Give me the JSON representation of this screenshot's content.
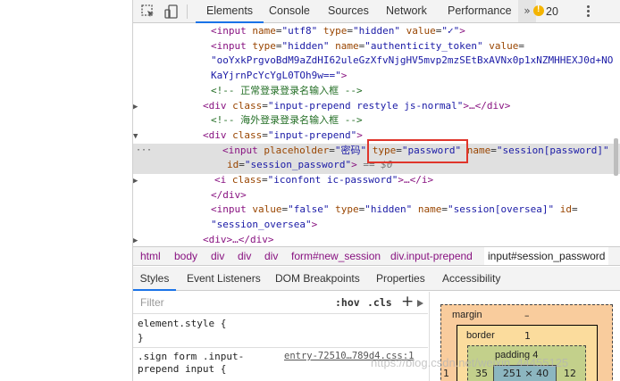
{
  "toolbar": {
    "tabs": [
      "Elements",
      "Console",
      "Sources",
      "Network",
      "Performance"
    ],
    "more": "»",
    "warnings_count": "20"
  },
  "dom": {
    "line1": {
      "tag_open": "<input ",
      "a1": "name",
      "v1": "\"utf8\"",
      "a2": "type",
      "v2": "\"hidden\"",
      "a3": "value",
      "v3": "\"✓\"",
      "close": ">"
    },
    "line2": {
      "tag_open": "<input ",
      "a1": "type",
      "v1": "\"hidden\"",
      "a2": "name",
      "v2": "\"authenticity_token\"",
      "a3": "value",
      "eq": "="
    },
    "line3": "\"ooYxkPrgvoBdM9aZdHI62uleGzXfvNjgHV5mvp2mzSEtBxAVNx0p1xNZMHHEXJ0d+NO",
    "line4": "KaYjrnPcYcYgL0TOh9w==\"",
    "line4_close": ">",
    "comment1": "<!-- 正常登录登录名输入框 -->",
    "line6": {
      "tag_open": "<div ",
      "a1": "class",
      "v1": "\"input-prepend restyle js-normal\"",
      "rest": ">…</div>"
    },
    "comment2": "<!-- 海外登录登录名输入框 -->",
    "line8": {
      "tag_open": "<div ",
      "a1": "class",
      "v1": "\"input-prepend\"",
      "close": ">"
    },
    "line9": {
      "tag_open": "<input ",
      "a1": "placeholder",
      "v1": "\"密码\"",
      "a2": "type",
      "v2": "\"password\"",
      "a3": "name",
      "v3": "\"session[password]\""
    },
    "line10": {
      "a1": "id",
      "v1": "\"session_password\"",
      "close": ">",
      "eq0": " == $0"
    },
    "line11": {
      "tag_open": "<i ",
      "a1": "class",
      "v1": "\"iconfont ic-password\"",
      "rest": ">…</i>"
    },
    "line12": "</div>",
    "line13": {
      "tag_open": "<input ",
      "a1": "value",
      "v1": "\"false\"",
      "a2": "type",
      "v2": "\"hidden\"",
      "a3": "name",
      "v3": "\"session[oversea]\"",
      "a4": "id",
      "eq": "="
    },
    "line14": "\"session_oversea\"",
    "line14_close": ">",
    "line15": {
      "tag_open": "<div",
      "rest": ">…</div>"
    },
    "dots": "···"
  },
  "breadcrumb": [
    "html",
    "body",
    "div",
    "div",
    "div",
    "form#new_session",
    "div.input-prepend",
    "input#session_password"
  ],
  "lower_tabs": [
    "Styles",
    "Event Listeners",
    "DOM Breakpoints",
    "Properties",
    "Accessibility"
  ],
  "styles": {
    "filter_placeholder": "Filter",
    "hov": ":hov",
    "cls": ".cls",
    "add": "+",
    "element_style_open": "element.style {",
    "element_style_close": "}",
    "rule_selector_1": ".sign form .input-",
    "rule_selector_2": "prepend input {",
    "rule_source": "entry-72510…789d4.css:1"
  },
  "box_model": {
    "margin_label": "margin",
    "margin_value": "–",
    "border_label": "border",
    "border_value": "1",
    "padding_label": "padding 4",
    "padding_left": "35",
    "padding_right": "12",
    "content": "251 × 40",
    "outer_left": "1"
  },
  "watermark": "https://blog.csdn.net/weixin_44455125",
  "colors": {
    "accent": "#1a73e8",
    "highlight": "#e0352b",
    "tag": "#881280",
    "attr": "#994500",
    "value": "#1a1aa6",
    "comment": "#236e25"
  }
}
